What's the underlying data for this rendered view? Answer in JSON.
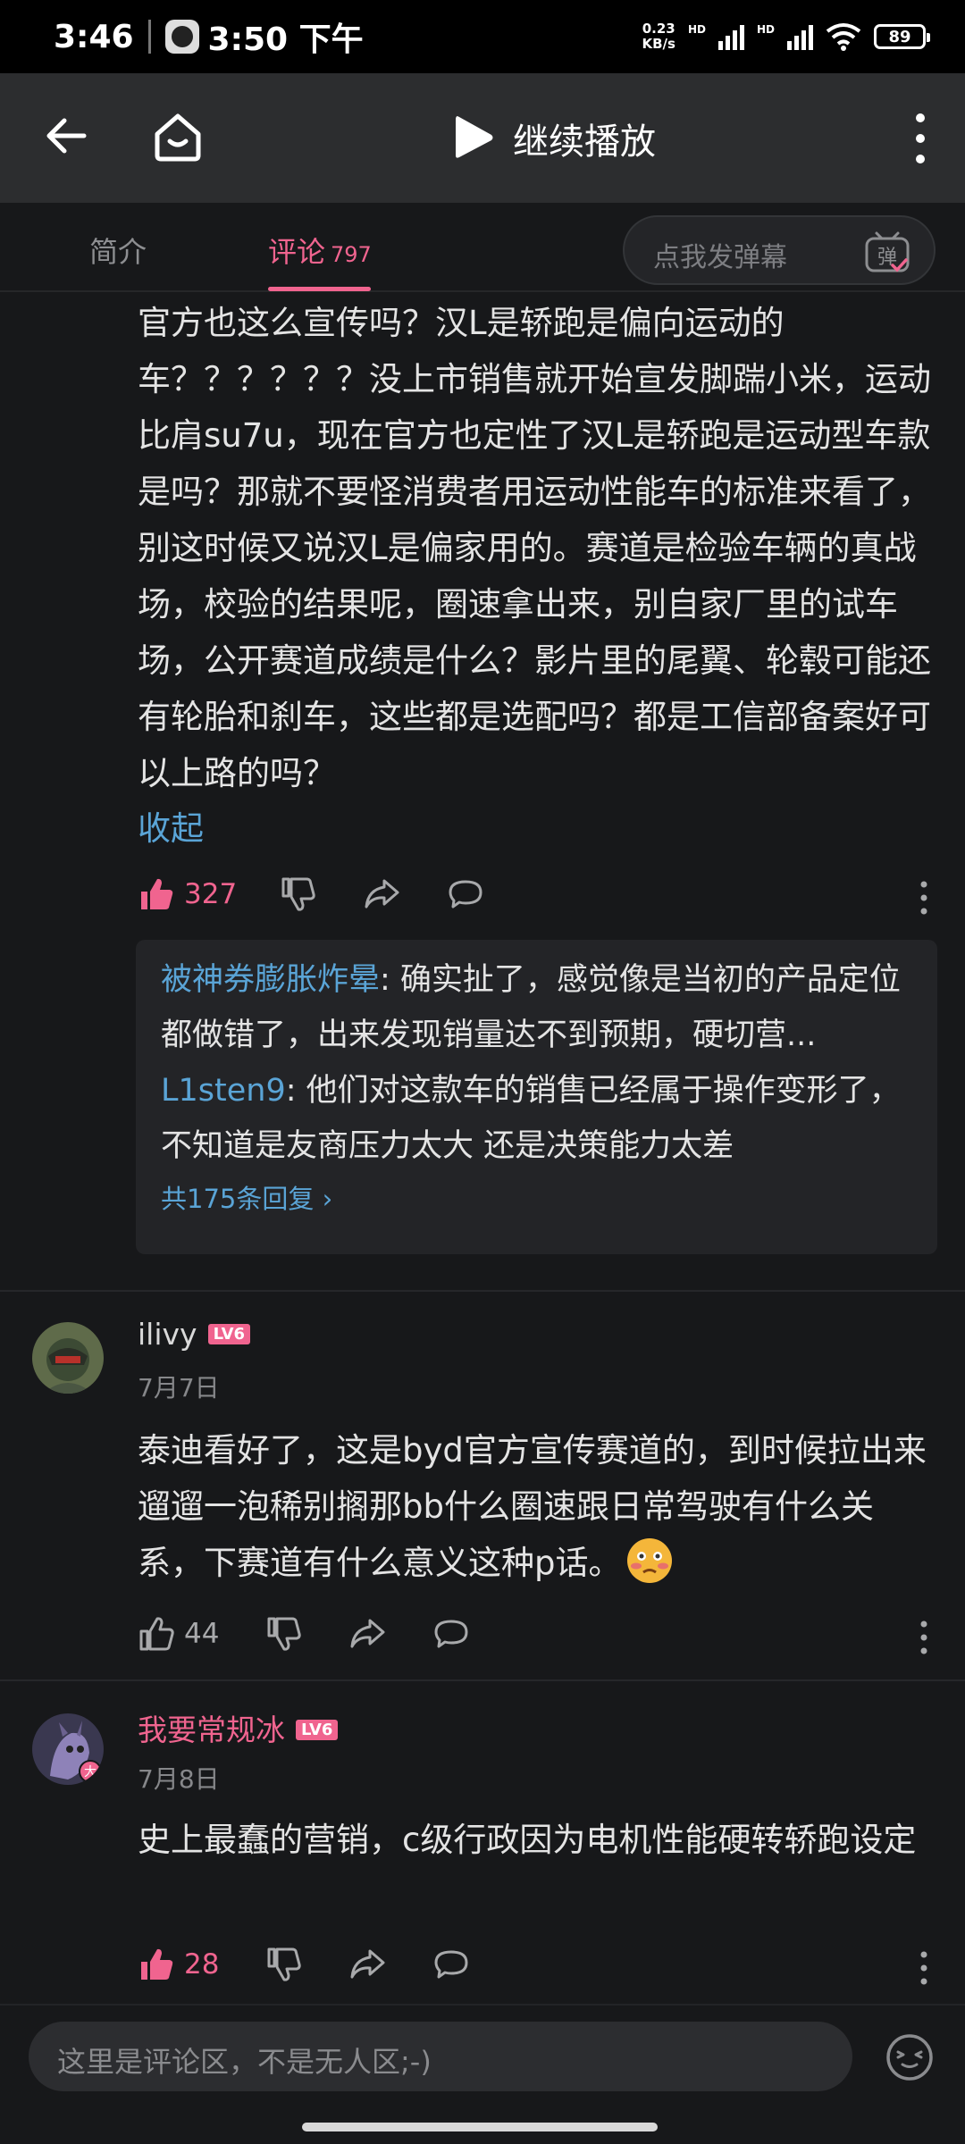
{
  "status_bar": {
    "time": "3:46",
    "clock_time": "3:50 下午",
    "net_speed": "0.23",
    "net_unit": "KB/s",
    "battery": "89"
  },
  "header": {
    "title": "继续播放"
  },
  "tabs": {
    "intro": "简介",
    "comments": "评论",
    "comments_count": "797",
    "danmaku_placeholder": "点我发弹幕"
  },
  "comments": [
    {
      "body": "官方也这么宣传吗？汉L是轿跑是偏向运动的车？？？？？？没上市销售就开始宣发脚踹小米，运动比肩su7u，现在官方也定性了汉L是轿跑是运动型车款是吗？那就不要怪消费者用运动性能车的标准来看了，别这时候又说汉L是偏家用的。赛道是检验车辆的真战场，校验的结果呢，圈速拿出来，别自家厂里的试车场，公开赛道成绩是什么？影片里的尾翼、轮毂可能还有轮胎和刹车，这些都是选配吗？都是工信部备案好可以上路的吗？",
      "collapse": "收起",
      "likes": "327",
      "replies": [
        {
          "user": "被神券膨胀炸晕",
          "text": ": 确实扯了，感觉像是当初的产品定位都做错了，出来发现销量达不到预期，硬切营..."
        },
        {
          "user": "L1sten9",
          "text": ": 他们对这款车的销售已经属于操作变形了，不知道是友商压力太大 还是决策能力太差"
        }
      ],
      "reply_total": "共175条回复 ›"
    },
    {
      "user": "ilivy",
      "level": "LV6",
      "date": "7月7日",
      "body": "泰迪看好了，这是byd官方宣传赛道的，到时候拉出来遛遛一泡稀别搁那bb什么圈速跟日常驾驶有什么关系，下赛道有什么意义这种p话。",
      "likes": "44"
    },
    {
      "user": "我要常规冰",
      "level": "LV6",
      "date": "7月8日",
      "body": "史上最蠢的营销，c级行政因为电机性能硬转轿跑设定",
      "likes": "28"
    }
  ],
  "input": {
    "placeholder": "这里是评论区，不是无人区;-)"
  },
  "colors": {
    "accent_pink": "#f0648f",
    "link_blue": "#5aa4d6",
    "background": "#17181a"
  }
}
